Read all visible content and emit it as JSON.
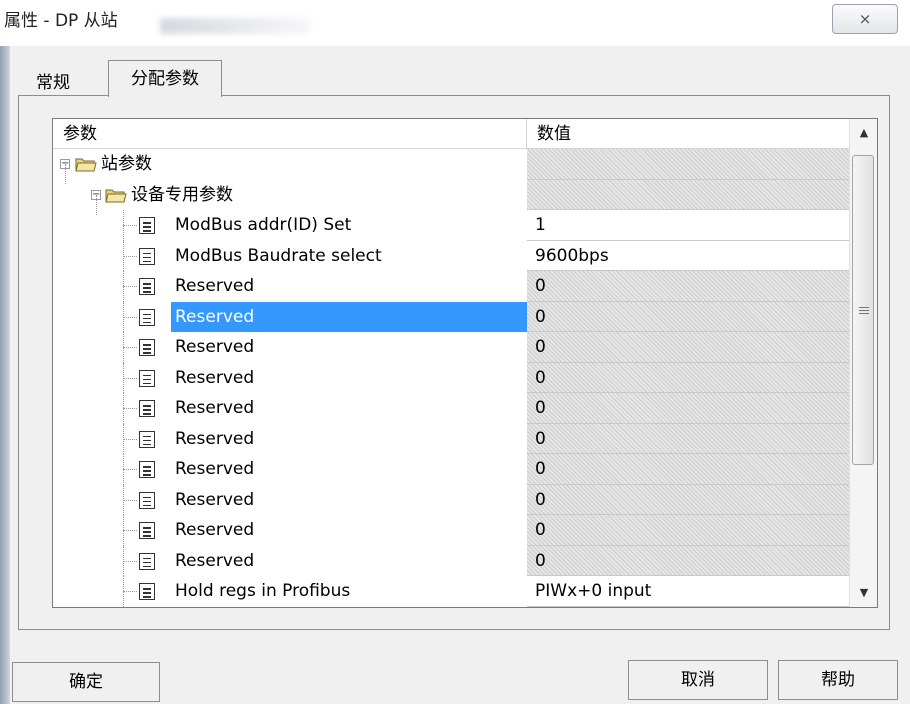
{
  "window": {
    "title": "属性 - DP 从站",
    "close_glyph": "⨯"
  },
  "tabs": [
    {
      "label": "常规"
    },
    {
      "label": "分配参数"
    }
  ],
  "table": {
    "headers": {
      "param": "参数",
      "value": "数值"
    },
    "rows": [
      {
        "label": "站参数",
        "value": "",
        "kind": "folder",
        "indent": 0,
        "hatched": true
      },
      {
        "label": "设备专用参数",
        "value": "",
        "kind": "folder",
        "indent": 1,
        "hatched": true
      },
      {
        "label": "ModBus addr(ID) Set",
        "value": "1",
        "kind": "param",
        "indent": 2,
        "hatched": false
      },
      {
        "label": "ModBus Baudrate select",
        "value": "9600bps",
        "kind": "param",
        "indent": 2,
        "hatched": false
      },
      {
        "label": "Reserved",
        "value": "0",
        "kind": "param",
        "indent": 2,
        "hatched": true
      },
      {
        "label": "Reserved",
        "value": "0",
        "kind": "param",
        "indent": 2,
        "hatched": true,
        "selected": true
      },
      {
        "label": "Reserved",
        "value": "0",
        "kind": "param",
        "indent": 2,
        "hatched": true
      },
      {
        "label": "Reserved",
        "value": "0",
        "kind": "param",
        "indent": 2,
        "hatched": true
      },
      {
        "label": "Reserved",
        "value": "0",
        "kind": "param",
        "indent": 2,
        "hatched": true
      },
      {
        "label": "Reserved",
        "value": "0",
        "kind": "param",
        "indent": 2,
        "hatched": true
      },
      {
        "label": "Reserved",
        "value": "0",
        "kind": "param",
        "indent": 2,
        "hatched": true
      },
      {
        "label": "Reserved",
        "value": "0",
        "kind": "param",
        "indent": 2,
        "hatched": true
      },
      {
        "label": "Reserved",
        "value": "0",
        "kind": "param",
        "indent": 2,
        "hatched": true
      },
      {
        "label": "Reserved",
        "value": "0",
        "kind": "param",
        "indent": 2,
        "hatched": true
      },
      {
        "label": "Hold regs in Profibus",
        "value": "PIWx+0  input",
        "kind": "param",
        "indent": 2,
        "hatched": false
      }
    ]
  },
  "buttons": {
    "ok": "确定",
    "cancel": "取消",
    "help": "帮助"
  },
  "colors": {
    "selection": "#3399ff",
    "border": "#8d8d8d"
  }
}
